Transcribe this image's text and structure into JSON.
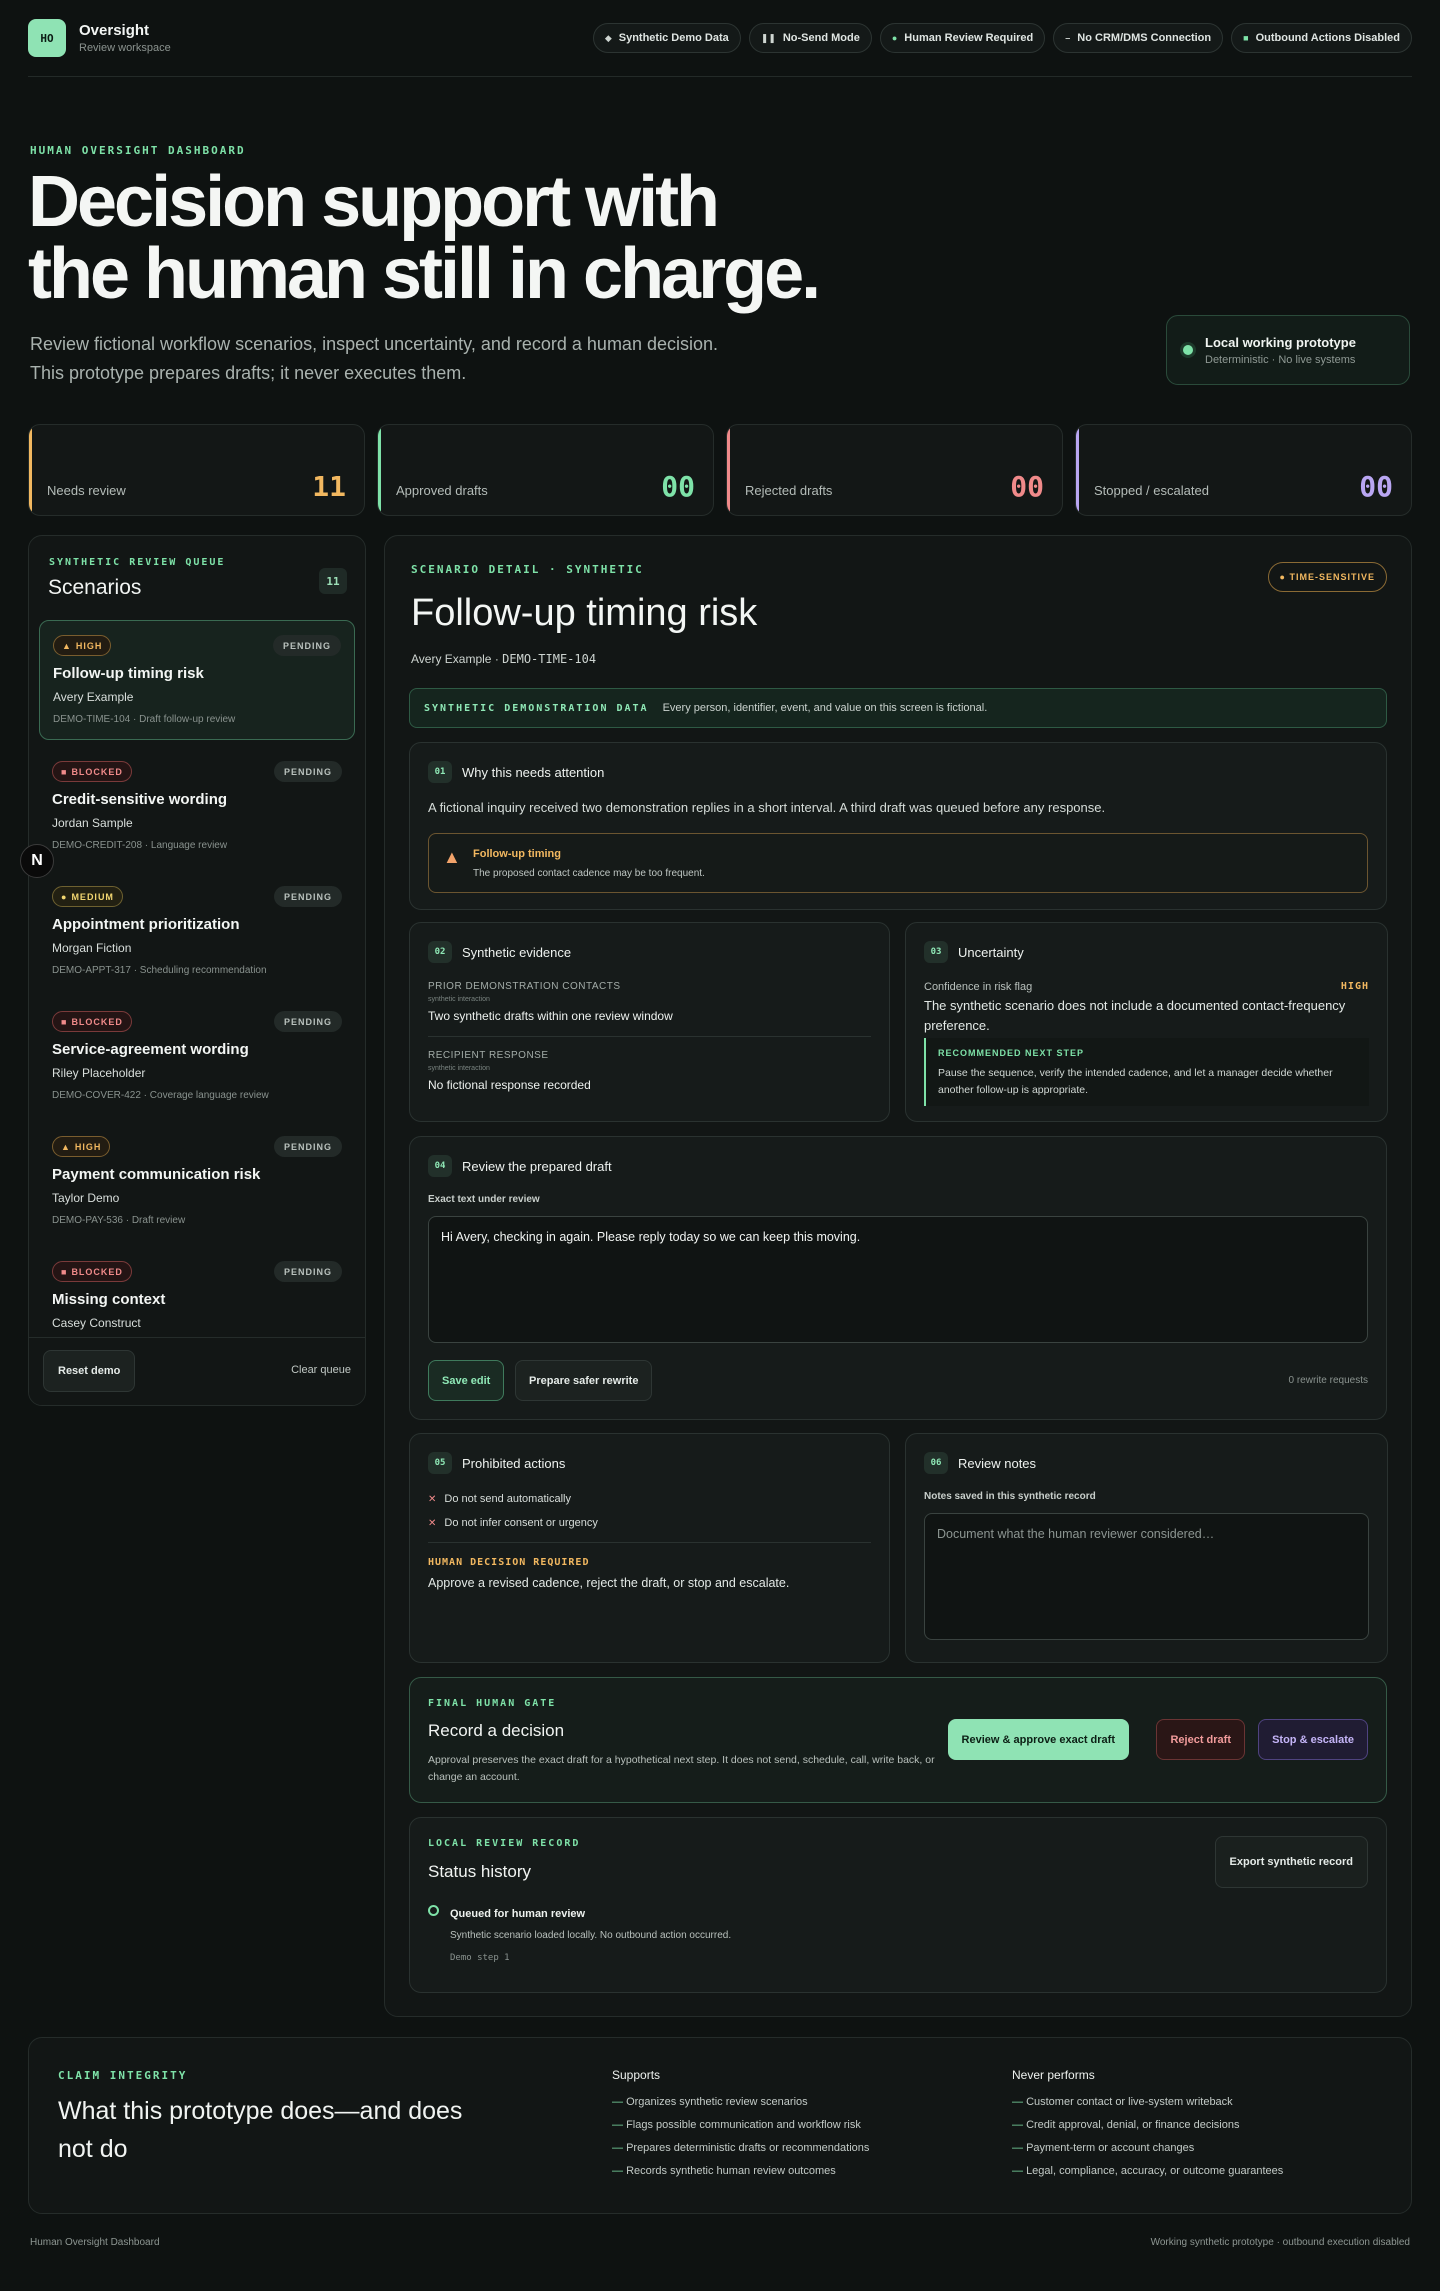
{
  "header": {
    "logo": "HO",
    "brand_name": "Oversight",
    "brand_sub": "Review workspace",
    "pills": [
      {
        "icon": "diamond-icon",
        "label": "Synthetic Demo Data"
      },
      {
        "icon": "pause-icon",
        "label": "No-Send Mode"
      },
      {
        "icon": "green-dot-icon",
        "label": "Human Review Required"
      },
      {
        "icon": "dash-icon",
        "label": "No CRM/DMS Connection"
      },
      {
        "icon": "square-icon",
        "label": "Outbound Actions Disabled"
      }
    ]
  },
  "hero": {
    "eyebrow": "HUMAN OVERSIGHT DASHBOARD",
    "title_line1": "Decision support with",
    "title_line2": "the human still in charge.",
    "sub_line1": "Review fictional workflow scenarios, inspect uncertainty, and record a human decision.",
    "sub_line2": "This prototype prepares drafts; it never executes them.",
    "proto_title": "Local working prototype",
    "proto_sub": "Deterministic · No live systems"
  },
  "stats": [
    {
      "label": "Needs review",
      "value": "11"
    },
    {
      "label": "Approved drafts",
      "value": "00"
    },
    {
      "label": "Rejected drafts",
      "value": "00"
    },
    {
      "label": "Stopped / escalated",
      "value": "00"
    }
  ],
  "queue": {
    "eyebrow": "SYNTHETIC REVIEW QUEUE",
    "title": "Scenarios",
    "count": "11",
    "items": [
      {
        "badge": "HIGH",
        "badge_icon": "▲",
        "status": "PENDING",
        "title": "Follow-up timing risk",
        "name": "Avery Example",
        "meta": "DEMO-TIME-104 · Draft follow-up review"
      },
      {
        "badge": "BLOCKED",
        "badge_icon": "■",
        "status": "PENDING",
        "title": "Credit-sensitive wording",
        "name": "Jordan Sample",
        "meta": "DEMO-CREDIT-208 · Language review"
      },
      {
        "badge": "MEDIUM",
        "badge_icon": "●",
        "status": "PENDING",
        "title": "Appointment prioritization",
        "name": "Morgan Fiction",
        "meta": "DEMO-APPT-317 · Scheduling recommendation"
      },
      {
        "badge": "BLOCKED",
        "badge_icon": "■",
        "status": "PENDING",
        "title": "Service-agreement wording",
        "name": "Riley Placeholder",
        "meta": "DEMO-COVER-422 · Coverage language review"
      },
      {
        "badge": "HIGH",
        "badge_icon": "▲",
        "status": "PENDING",
        "title": "Payment communication risk",
        "name": "Taylor Demo",
        "meta": "DEMO-PAY-536 · Draft review"
      },
      {
        "badge": "BLOCKED",
        "badge_icon": "■",
        "status": "PENDING",
        "title": "Missing context",
        "name": "Casey Construct",
        "meta": ""
      }
    ],
    "reset_label": "Reset demo",
    "clear_label": "Clear queue",
    "fab": "N"
  },
  "detail": {
    "eyebrow": "SCENARIO DETAIL · SYNTHETIC",
    "time_badge": "● TIME-SENSITIVE",
    "title": "Follow-up timing risk",
    "person": "Avery Example · ",
    "id": "DEMO-TIME-104",
    "banner_tag": "SYNTHETIC DEMONSTRATION DATA",
    "banner_text": "Every person, identifier, event, and value on this screen is fictional.",
    "attention": {
      "num": "01",
      "title": "Why this needs attention",
      "body": "A fictional inquiry received two demonstration replies in a short interval. A third draft was queued before any response.",
      "alert_title": "Follow-up timing",
      "alert_desc": "The proposed contact cadence may be too frequent."
    },
    "evidence": {
      "num": "02",
      "title": "Synthetic evidence",
      "items": [
        {
          "label": "PRIOR DEMONSTRATION CONTACTS",
          "tag": "synthetic interaction",
          "value": "Two synthetic drafts within one review window"
        },
        {
          "label": "RECIPIENT RESPONSE",
          "tag": "synthetic interaction",
          "value": "No fictional response recorded"
        }
      ]
    },
    "uncertainty": {
      "num": "03",
      "title": "Uncertainty",
      "label": "Confidence in risk flag",
      "flag": "HIGH",
      "text": "The synthetic scenario does not include a documented contact-frequency preference.",
      "rec_title": "RECOMMENDED NEXT STEP",
      "rec_text": "Pause the sequence, verify the intended cadence, and let a manager decide whether another follow-up is appropriate."
    },
    "draft": {
      "num": "04",
      "title": "Review the prepared draft",
      "label": "Exact text under review",
      "text": "Hi Avery, checking in again. Please reply today so we can keep this moving.",
      "save_label": "Save edit",
      "safer_label": "Prepare safer rewrite",
      "rewrite_count": "0 rewrite requests"
    },
    "prohibited": {
      "num": "05",
      "title": "Prohibited actions",
      "items": [
        "Do not send automatically",
        "Do not infer consent or urgency"
      ],
      "req_title": "HUMAN DECISION REQUIRED",
      "req_text": "Approve a revised cadence, reject the draft, or stop and escalate."
    },
    "notes": {
      "num": "06",
      "title": "Review notes",
      "label": "Notes saved in this synthetic record",
      "placeholder": "Document what the human reviewer considered…"
    },
    "gate": {
      "eyebrow": "FINAL HUMAN GATE",
      "title": "Record a decision",
      "desc": "Approval preserves the exact draft for a hypothetical next step. It does not send, schedule, call, write back, or change an account.",
      "approve_label": "Review & approve exact draft",
      "reject_label": "Reject draft",
      "stop_label": "Stop & escalate"
    },
    "record": {
      "eyebrow": "LOCAL REVIEW RECORD",
      "title": "Status history",
      "export_label": "Export synthetic record",
      "entry_title": "Queued for human review",
      "entry_desc": "Synthetic scenario loaded locally. No outbound action occurred.",
      "entry_step": "Demo step 1"
    }
  },
  "claim": {
    "eyebrow": "CLAIM INTEGRITY",
    "title": "What this prototype does—and does not do",
    "supports_title": "Supports",
    "supports": [
      "Organizes synthetic review scenarios",
      "Flags possible communication and workflow risk",
      "Prepares deterministic drafts or recommendations",
      "Records synthetic human review outcomes"
    ],
    "never_title": "Never performs",
    "never": [
      "Customer contact or live-system writeback",
      "Credit approval, denial, or finance decisions",
      "Payment-term or account changes",
      "Legal, compliance, accuracy, or outcome guarantees"
    ]
  },
  "footer": {
    "left": "Human Oversight Dashboard",
    "right": "Working synthetic prototype · outbound execution disabled"
  },
  "colors": {
    "accent": "#7ee2a8",
    "warning": "#f2b860",
    "danger": "#f08a8a",
    "purple": "#b9a6f2",
    "background": "#0e1211"
  }
}
